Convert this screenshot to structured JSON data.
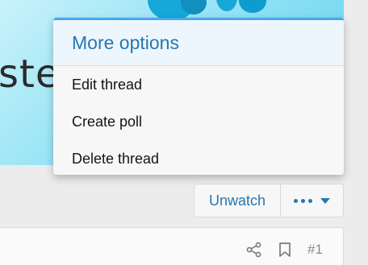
{
  "menu": {
    "title": "More options",
    "items": [
      {
        "label": "Edit thread"
      },
      {
        "label": "Create poll"
      },
      {
        "label": "Delete thread"
      }
    ]
  },
  "banner": {
    "partial_text": "ster"
  },
  "buttons": {
    "unwatch_label": "Unwatch"
  },
  "post": {
    "number": "#1"
  },
  "colors": {
    "accent": "#2577b1",
    "menu_top_border": "#47a7eb"
  }
}
